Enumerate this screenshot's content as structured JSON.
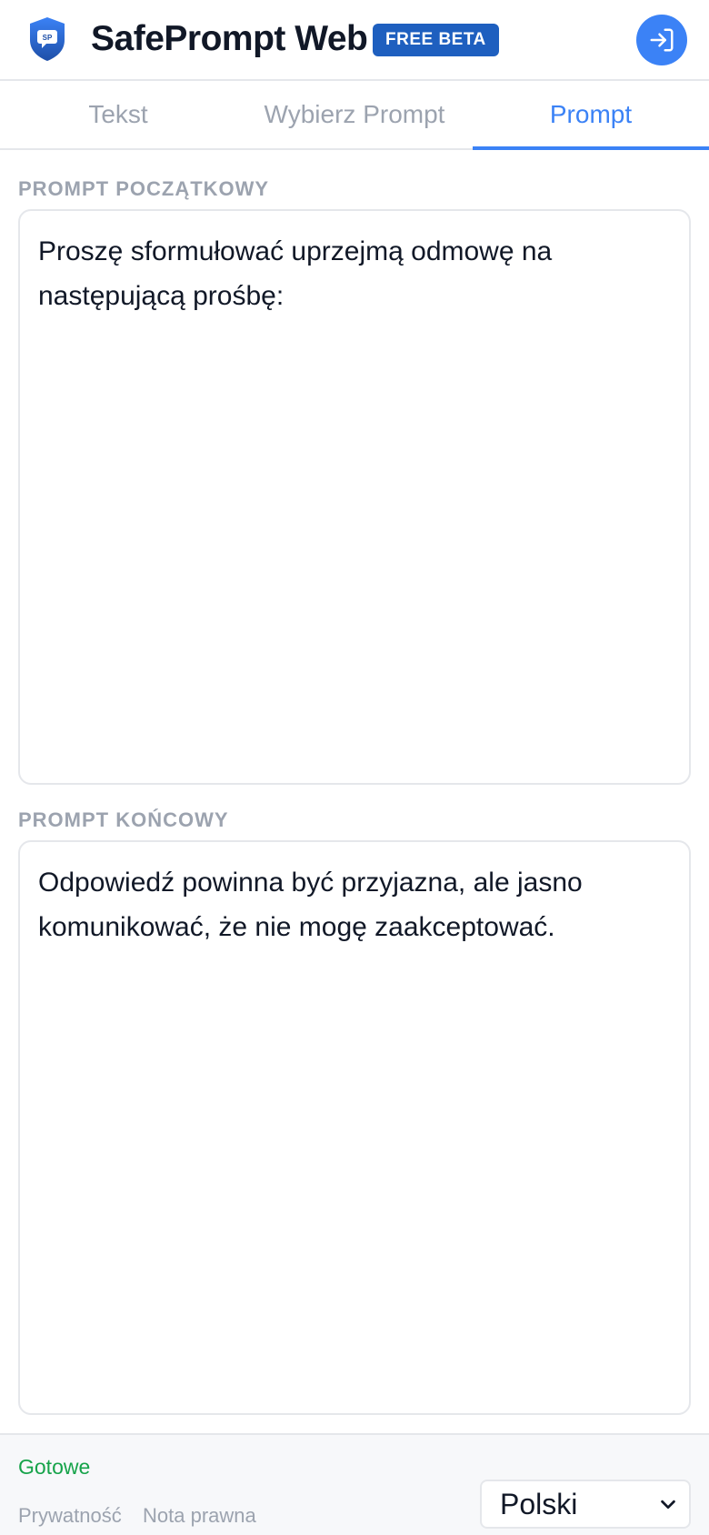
{
  "header": {
    "logo_text": "SP",
    "title": "SafePrompt Web",
    "badge": "FREE BETA",
    "login_icon": "login-arrow-icon"
  },
  "tabs": [
    {
      "label": "Tekst",
      "active": false
    },
    {
      "label": "Wybierz Prompt",
      "active": false
    },
    {
      "label": "Prompt",
      "active": true
    }
  ],
  "initial_prompt": {
    "label": "PROMPT POCZĄTKOWY",
    "value": "Proszę sformułować uprzejmą odmowę na następującą prośbę:"
  },
  "final_prompt": {
    "label": "PROMPT KOŃCOWY",
    "value": "Odpowiedź powinna być przyjazna, ale jasno komunikować, że nie mogę zaakceptować."
  },
  "footer": {
    "status": "Gotowe",
    "privacy_link": "Prywatność",
    "legal_link": "Nota prawna",
    "language": "Polski"
  },
  "colors": {
    "accent": "#3b82f6",
    "badge": "#1e5fbf",
    "status_ok": "#16a34a",
    "muted": "#9ca3af"
  }
}
